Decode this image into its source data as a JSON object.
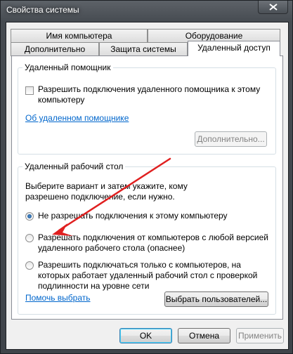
{
  "window": {
    "title": "Свойства системы"
  },
  "tabs": {
    "row1": [
      "Имя компьютера",
      "Оборудование"
    ],
    "row2": [
      "Дополнительно",
      "Защита системы",
      "Удаленный доступ"
    ]
  },
  "assistance": {
    "group_title": "Удаленный помощник",
    "checkbox_label": "Разрешить подключения удаленного помощника к этому компьютеру",
    "checkbox_checked": false,
    "link": "Об удаленном помощнике",
    "advanced_button": "Дополнительно..."
  },
  "desktop": {
    "group_title": "Удаленный рабочий стол",
    "description": "Выберите вариант и затем укажите, кому разрешено подключение, если нужно.",
    "options": [
      {
        "label": "Не разрешать подключения к этому компьютеру",
        "checked": true
      },
      {
        "label": "Разрешать подключения от компьютеров с любой версией удаленного рабочего стола (опаснее)",
        "checked": false
      },
      {
        "label": "Разрешить подключаться только с компьютеров, на которых работает удаленный рабочий стол с проверкой подлинности на уровне сети",
        "checked": false
      }
    ],
    "help_link": "Помочь выбрать",
    "select_users_button": "Выбрать пользователей..."
  },
  "footer": {
    "ok": "OK",
    "cancel": "Отмена",
    "apply": "Применить"
  },
  "colors": {
    "annotation_arrow": "#e02020",
    "link": "#0066cc"
  }
}
